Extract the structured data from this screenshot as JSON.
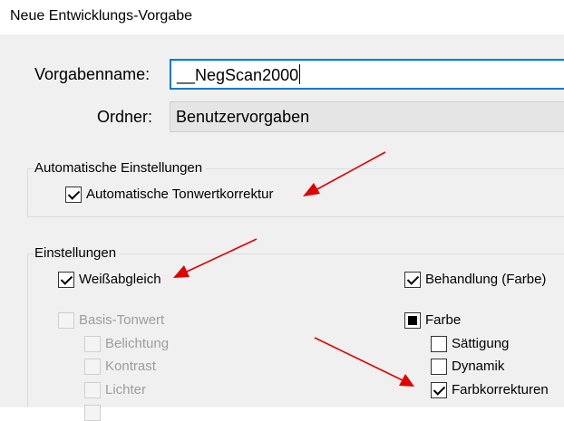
{
  "window": {
    "title": "Neue Entwicklungs-Vorgabe"
  },
  "form": {
    "name_label": "Vorgabenname:",
    "name_value": "__NegScan2000",
    "folder_label": "Ordner:",
    "folder_value": "Benutzervorgaben"
  },
  "auto_group": {
    "title": "Automatische Einstellungen",
    "auto_tone": {
      "label": "Automatische Tonwertkorrektur",
      "checked": true
    }
  },
  "settings_group": {
    "title": "Einstellungen",
    "white_balance": {
      "label": "Weißabgleich",
      "checked": true
    },
    "basic_tone": {
      "label": "Basis-Tonwert",
      "checked": false,
      "enabled": false
    },
    "exposure": {
      "label": "Belichtung",
      "checked": false,
      "enabled": false
    },
    "contrast": {
      "label": "Kontrast",
      "checked": false,
      "enabled": false
    },
    "highlights": {
      "label": "Lichter",
      "checked": false,
      "enabled": false
    },
    "treatment": {
      "label": "Behandlung (Farbe)",
      "checked": true
    },
    "color": {
      "label": "Farbe",
      "state": "mixed"
    },
    "saturation": {
      "label": "Sättigung",
      "checked": false
    },
    "vibrance": {
      "label": "Dynamik",
      "checked": false
    },
    "color_corrections": {
      "label": "Farbkorrekturen",
      "checked": true
    }
  },
  "annotation": {
    "arrow_color": "#e00000"
  }
}
